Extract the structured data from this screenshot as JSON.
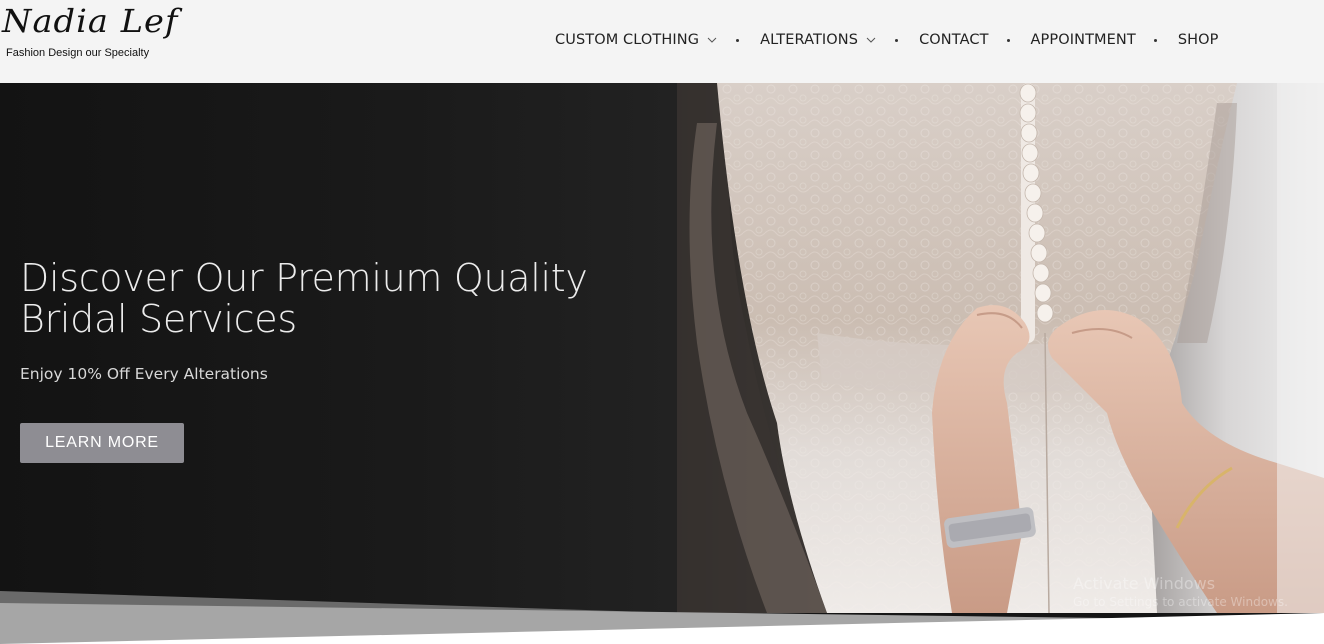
{
  "brand": {
    "logo_script": "Nadia Lef",
    "tagline": "Fashion Design our Specialty"
  },
  "nav": {
    "items": [
      {
        "label": "CUSTOM CLOTHING",
        "has_dropdown": true
      },
      {
        "label": "ALTERATIONS",
        "has_dropdown": true
      },
      {
        "label": "CONTACT",
        "has_dropdown": false
      },
      {
        "label": "APPOINTMENT",
        "has_dropdown": false
      },
      {
        "label": "SHOP",
        "has_dropdown": false
      }
    ]
  },
  "hero": {
    "title": "Discover Our Premium Quality Bridal Services",
    "subtitle": "Enjoy 10% Off Every Alterations",
    "button_label": "LEARN MORE",
    "image_icon": "bridal-dress-photo"
  },
  "watermark": {
    "title": "Activate Windows",
    "subtitle": "Go to Settings to activate Windows."
  },
  "colors": {
    "header_bg": "#f4f4f4",
    "hero_bg": "#151515",
    "button_bg": "#8e8d93",
    "text_light": "#ececec"
  }
}
